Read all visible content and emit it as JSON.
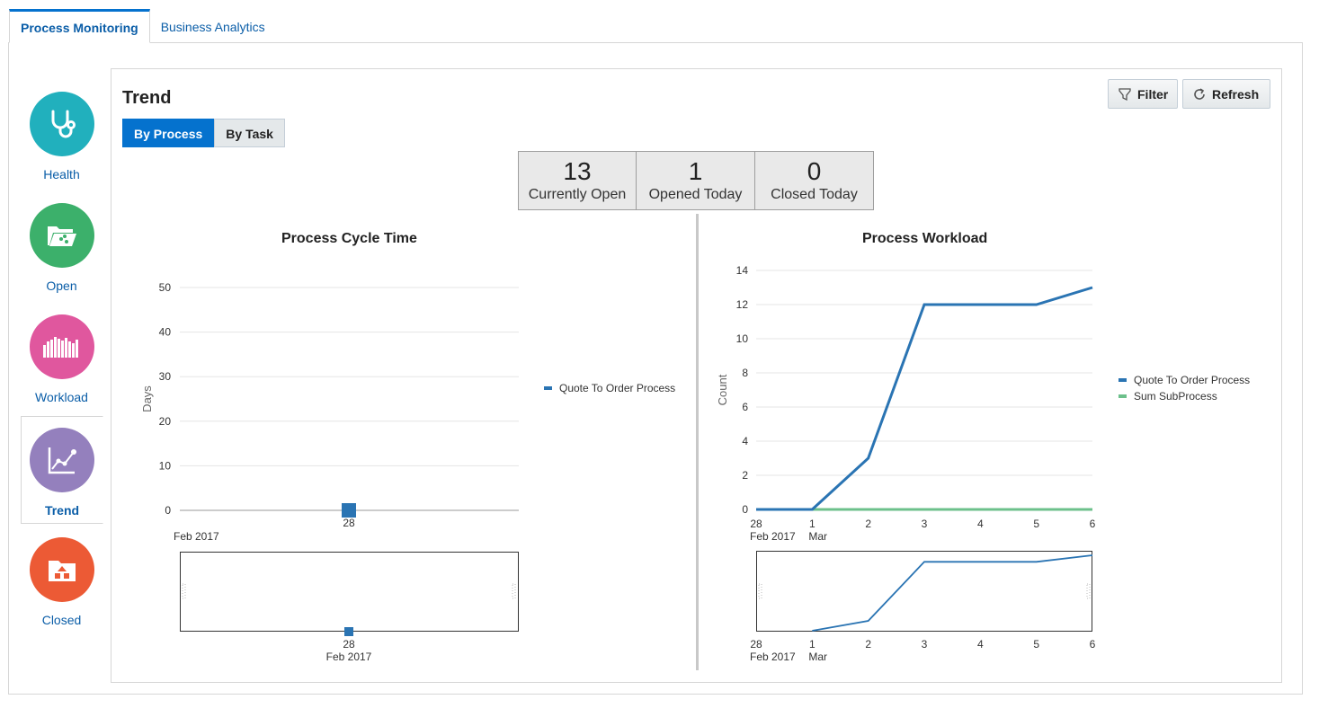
{
  "tabs": [
    {
      "label": "Process Monitoring"
    },
    {
      "label": "Business Analytics"
    }
  ],
  "sidebar": {
    "items": [
      {
        "label": "Health",
        "icon": "stethoscope-icon",
        "color": "#21b0bd"
      },
      {
        "label": "Open",
        "icon": "open-folder-icon",
        "color": "#3cb06b"
      },
      {
        "label": "Workload",
        "icon": "bar-chart-icon",
        "color": "#e0579e"
      },
      {
        "label": "Trend",
        "icon": "line-chart-icon",
        "color": "#9480bd"
      },
      {
        "label": "Closed",
        "icon": "closed-folder-icon",
        "color": "#ec5a35"
      }
    ]
  },
  "main": {
    "title": "Trend",
    "toggle": {
      "by_process": "By Process",
      "by_task": "By Task"
    },
    "filter_label": "Filter",
    "refresh_label": "Refresh",
    "kpis": [
      {
        "value": "13",
        "caption": "Currently Open"
      },
      {
        "value": "1",
        "caption": "Opened Today"
      },
      {
        "value": "0",
        "caption": "Closed Today"
      }
    ]
  },
  "colors": {
    "accent": "#0572ce",
    "series_blue": "#2a74b3",
    "series_green": "#6cc08b"
  },
  "chart_data": [
    {
      "type": "scatter",
      "title": "Process Cycle Time",
      "xlabel": "",
      "ylabel": "Days",
      "ylim": [
        0,
        50
      ],
      "yticks": [
        "0",
        "10",
        "20",
        "30",
        "40",
        "50"
      ],
      "x": [
        "28"
      ],
      "x_sub": [
        "Feb 2017"
      ],
      "series": [
        {
          "name": "Quote To Order Process",
          "values": [
            0
          ]
        }
      ],
      "overview": {
        "x": [
          "28"
        ],
        "x_sub": [
          "Feb 2017"
        ]
      },
      "grid": true,
      "legend": "right"
    },
    {
      "type": "line",
      "title": "Process Workload",
      "xlabel": "",
      "ylabel": "Count",
      "ylim": [
        0,
        14
      ],
      "yticks": [
        "0",
        "2",
        "4",
        "6",
        "8",
        "10",
        "12",
        "14"
      ],
      "x": [
        "28",
        "1",
        "2",
        "3",
        "4",
        "5",
        "6"
      ],
      "x_sub": [
        "Feb 2017",
        "Mar",
        "",
        "",
        "",
        "",
        ""
      ],
      "series": [
        {
          "name": "Quote To Order Process",
          "values": [
            0,
            0,
            3,
            12,
            12,
            12,
            13
          ]
        },
        {
          "name": "Sum SubProcess",
          "values": [
            0,
            0,
            0,
            0,
            0,
            0,
            0
          ]
        }
      ],
      "grid": true,
      "legend": "right"
    }
  ]
}
